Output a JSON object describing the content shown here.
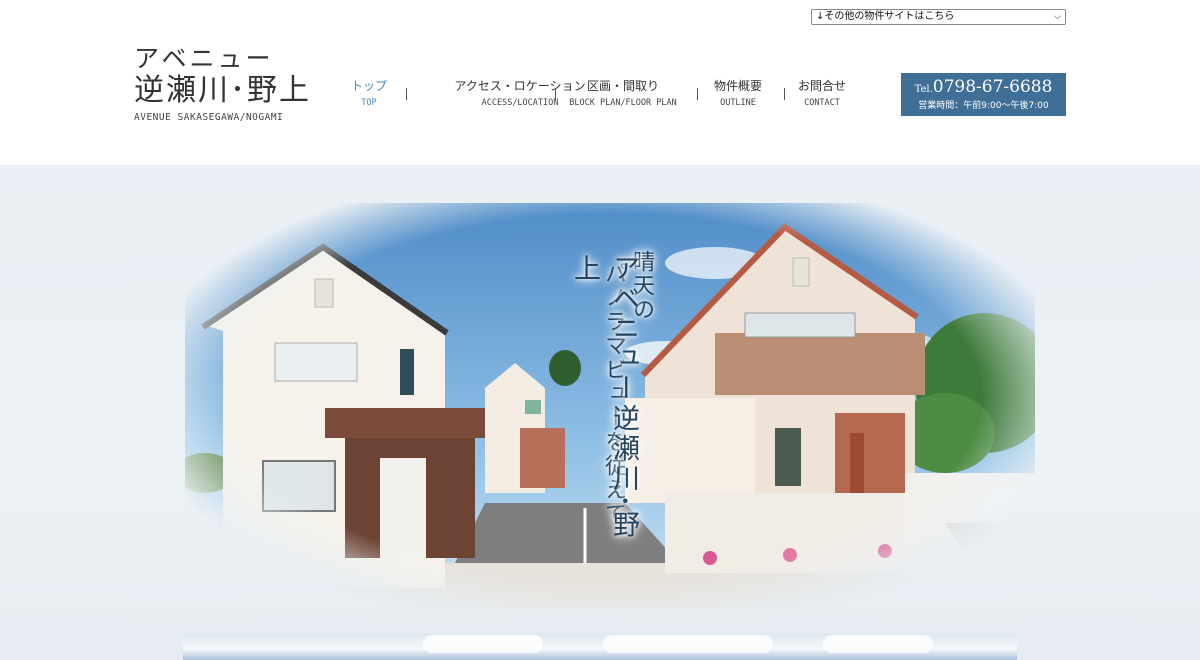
{
  "site_selector": {
    "label": "↓その他の物件サイトはこちら"
  },
  "logo": {
    "line1": "アベニュー",
    "line2": "逆瀬川･野上",
    "line3": "AVENUE SAKASEGAWA/NOGAMI"
  },
  "nav": {
    "items": [
      {
        "jp": "トップ",
        "en": "TOP",
        "active": true
      },
      {
        "jp": "アクセス・ロケーション",
        "en": "ACCESS/LOCATION",
        "active": false
      },
      {
        "jp": "区画・間取り",
        "en": "BLOCK PLAN/FLOOR PLAN",
        "active": false
      },
      {
        "jp": "物件概要",
        "en": "OUTLINE",
        "active": false
      },
      {
        "jp": "お問合せ",
        "en": "CONTACT",
        "active": false
      }
    ]
  },
  "contact": {
    "tel_prefix": "Tel.",
    "tel_number": "0798-67-6688",
    "hours": "営業時間：午前9:00～午後7:00"
  },
  "hero": {
    "catch_lines": [
      "晴天の",
      "パノラマビューを従えて。",
      "アベニュー逆瀬川･野上"
    ]
  },
  "colors": {
    "accent": "#4a8ab8",
    "tel_bg": "#3f6e96",
    "hero_bg": "#e9eff4",
    "catch_text": "#24445f"
  },
  "icons": {
    "select_chevron": "chevron-down-icon"
  }
}
